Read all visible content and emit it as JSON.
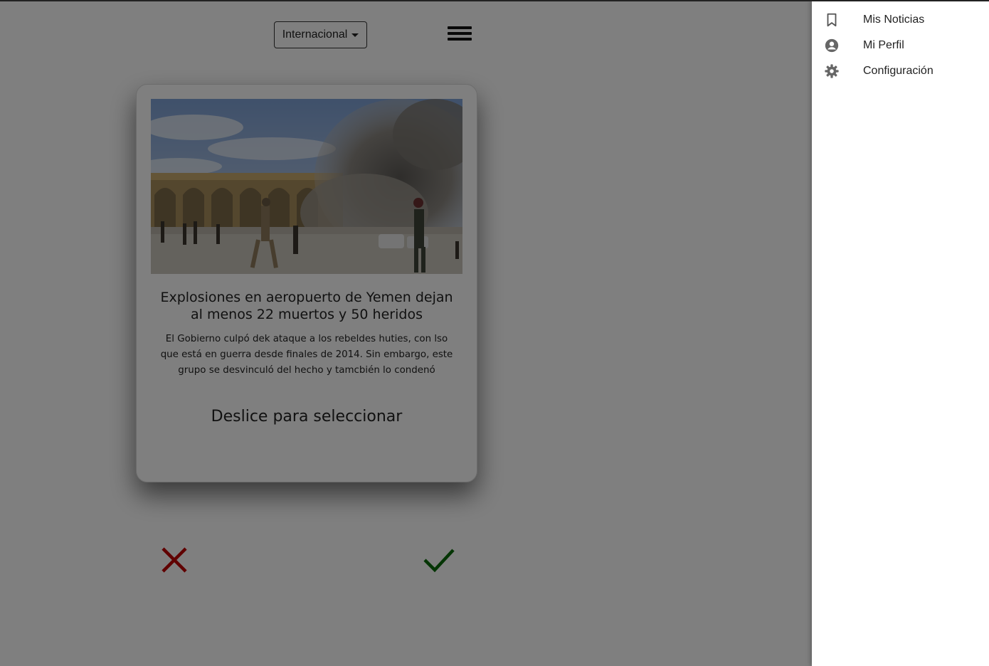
{
  "header": {
    "category_select": {
      "label": "Internacional"
    },
    "menu_icon": "hamburger-menu-icon"
  },
  "card": {
    "title": "Explosiones en aeropuerto de Yemen dejan al menos 22 muertos y 50 heridos",
    "summary": "El Gobierno culpó dek ataque a los rebeldes huties, con lso que está en guerra desde finales de 2014. Sin embargo, este grupo se desvinculó del hecho y tamcbién lo condenó",
    "hint": "Deslice para seleccionar"
  },
  "actions": {
    "reject_icon": "close-icon",
    "accept_icon": "check-icon",
    "reject_color": "#c00000",
    "accept_color": "#0a6b0a"
  },
  "drawer": {
    "items": [
      {
        "label": "Mis Noticias",
        "icon": "bookmark-icon"
      },
      {
        "label": "Mi Perfil",
        "icon": "account-circle-icon"
      },
      {
        "label": "Configuración",
        "icon": "gear-icon"
      }
    ]
  },
  "colors": {
    "overlay": "rgba(0,0,0,0.5)",
    "drawer_background": "#ffffff",
    "card_background": "#ffffff"
  }
}
